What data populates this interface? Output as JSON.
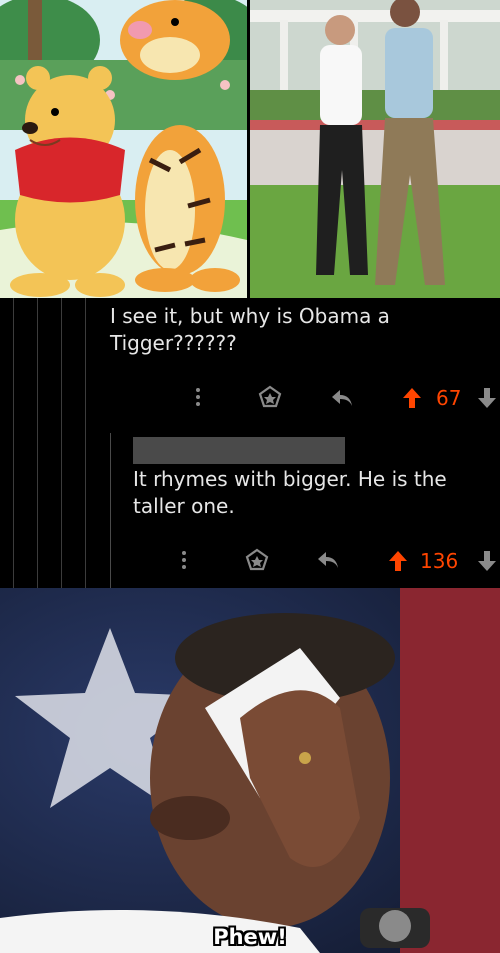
{
  "top_images": {
    "left": {
      "icon": "pooh-and-tigger-cartoon"
    },
    "right": {
      "icon": "two-men-walking-photo"
    }
  },
  "comments": [
    {
      "text": "I see it, but why is Obama a Tigger??????",
      "score": "67",
      "more_icon": "more-vertical-icon",
      "award_icon": "award-icon",
      "reply_icon": "reply-icon",
      "upvote_icon": "upvote-icon",
      "downvote_icon": "downvote-icon"
    },
    {
      "author_redacted": true,
      "text": "It rhymes with bigger. He is the taller one.",
      "score": "136"
    }
  ],
  "meme": {
    "caption": "Phew!",
    "icon": "man-wiping-forehead-photo"
  },
  "colors": {
    "background": "#000000",
    "text": "#e6e6e6",
    "vote_accent": "#ff4500",
    "icon_gray": "#8a8a8a",
    "thread_line": "#3c3c3c"
  }
}
